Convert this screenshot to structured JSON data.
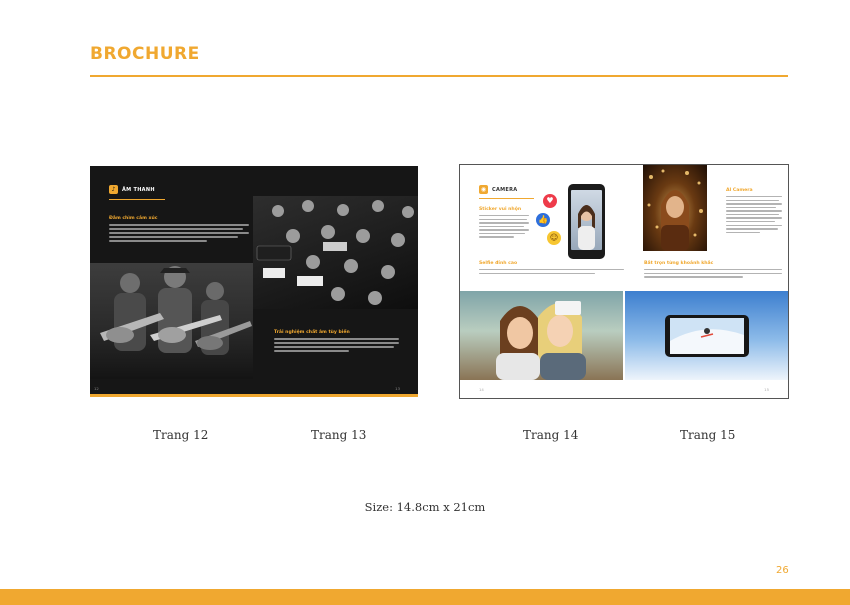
{
  "header": {
    "title": "BROCHURE"
  },
  "spread_left": {
    "section_label": "ÂM THANH",
    "heading_1": "Đắm chìm cảm xúc",
    "heading_2": "Trải nghiệm chất âm tùy biến",
    "page_left": "12",
    "page_right": "13"
  },
  "spread_right": {
    "section_label": "CAMERA",
    "heading_sticker": "Sticker vui nhộn",
    "heading_selfie": "Selfie đỉnh cao",
    "heading_ai": "AI Camera",
    "heading_capture": "Bắt trọn từng khoảnh khắc",
    "page_left": "14",
    "page_right": "15"
  },
  "captions": {
    "page_12": "Trang 12",
    "page_13": "Trang 13",
    "page_14": "Trang 14",
    "page_15": "Trang 15"
  },
  "size_label": "Size: 14.8cm x 21cm",
  "page_number": "26",
  "colors": {
    "accent": "#f0a830",
    "dark_spread": "#161616",
    "text": "#333333"
  }
}
